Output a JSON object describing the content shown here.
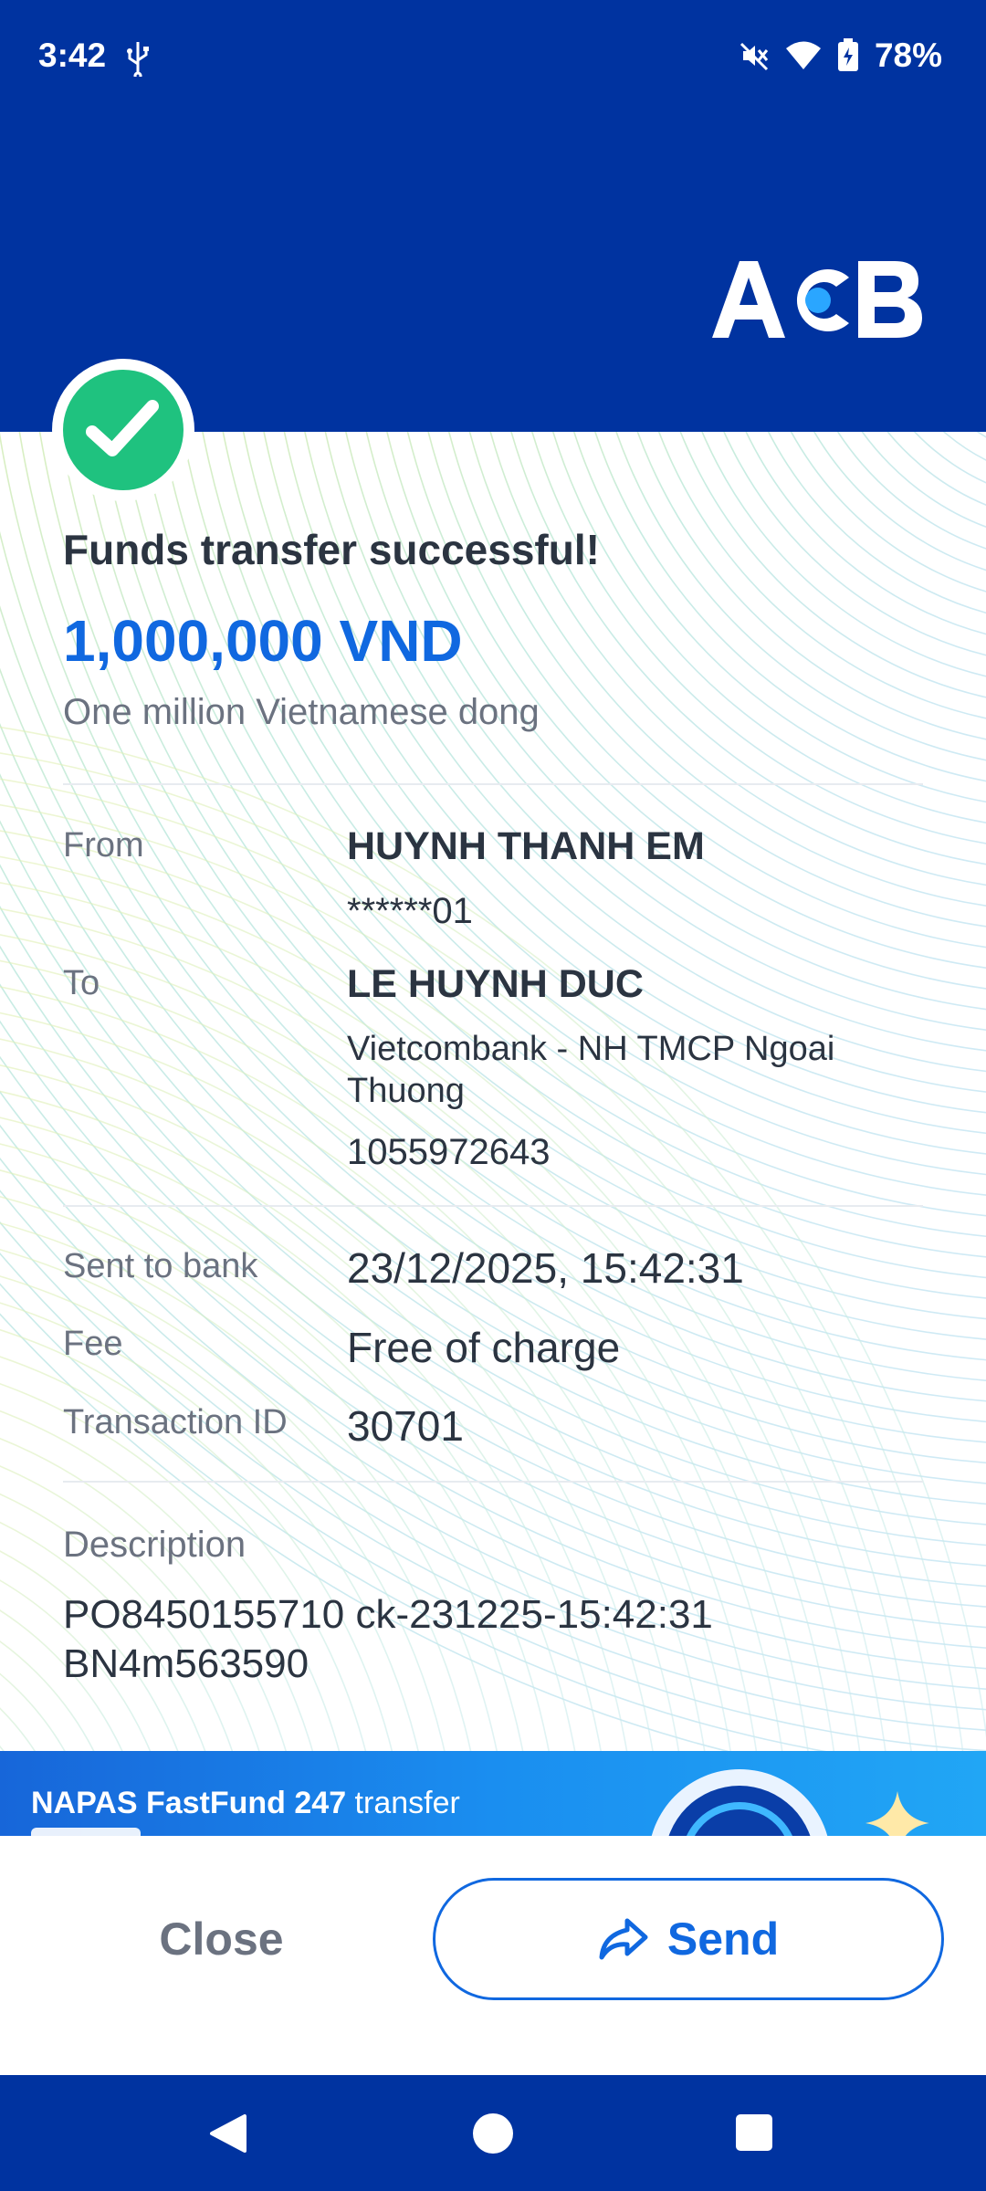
{
  "status_bar": {
    "time": "3:42",
    "battery": "78%"
  },
  "brand": {
    "logo_text": "ACB"
  },
  "receipt": {
    "title": "Funds transfer successful!",
    "amount": "1,000,000 VND",
    "amount_words": "One million Vietnamese dong",
    "from_label": "From",
    "from_name": "HUYNH THANH EM",
    "from_account": "******01",
    "to_label": "To",
    "to_name": "LE HUYNH DUC",
    "to_bank": "Vietcombank - NH TMCP Ngoai Thuong",
    "to_account": "1055972643",
    "sent_label": "Sent to bank",
    "sent_value": "23/12/2025, 15:42:31",
    "fee_label": "Fee",
    "fee_value": "Free of charge",
    "txn_label": "Transaction ID",
    "txn_value": "30701",
    "description_label": "Description",
    "description_value": "PO8450155710 ck-231225-15:42:31 BN4m563590"
  },
  "banner": {
    "bold_text": "NAPAS FastFund 247",
    "text": " transfer"
  },
  "actions": {
    "close_label": "Close",
    "send_label": "Send"
  },
  "colors": {
    "header_blue": "#0033a0",
    "accent_blue": "#1068e0",
    "success_green": "#1fc27f"
  }
}
